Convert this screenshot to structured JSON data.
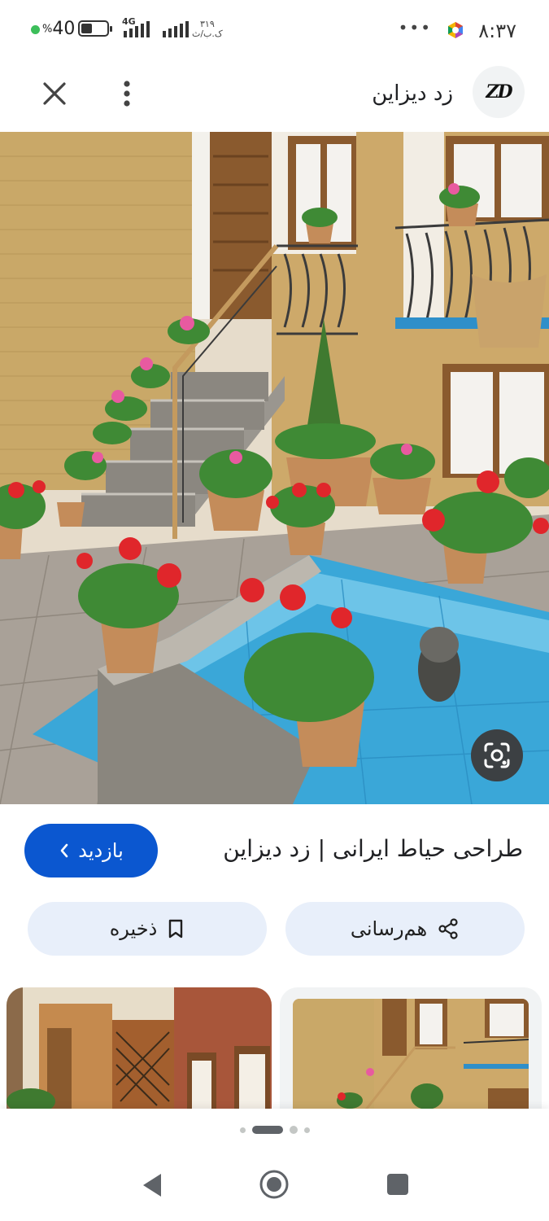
{
  "status_bar": {
    "time": "۸:۳۷",
    "battery_percent": "40",
    "percent_sign": "%",
    "network": "4G",
    "data_speed": "۳۱۹",
    "data_speed_unit": "ک.ب/ث",
    "more": "•••"
  },
  "header": {
    "site_name": "زد دیزاین",
    "logo_text": "ZD"
  },
  "image": {
    "title": "طراحی حیاط ایرانی | زد دیزاین"
  },
  "actions": {
    "visit_label": "بازدید",
    "share_label": "هم‌رسانی",
    "save_label": "ذخیره"
  },
  "pager": {
    "pages": 4,
    "active": 1
  },
  "colors": {
    "accent": "#0b57d0",
    "chip_bg": "#e8effa",
    "pool": "#3aa7d8",
    "brick": "#c9a868"
  }
}
